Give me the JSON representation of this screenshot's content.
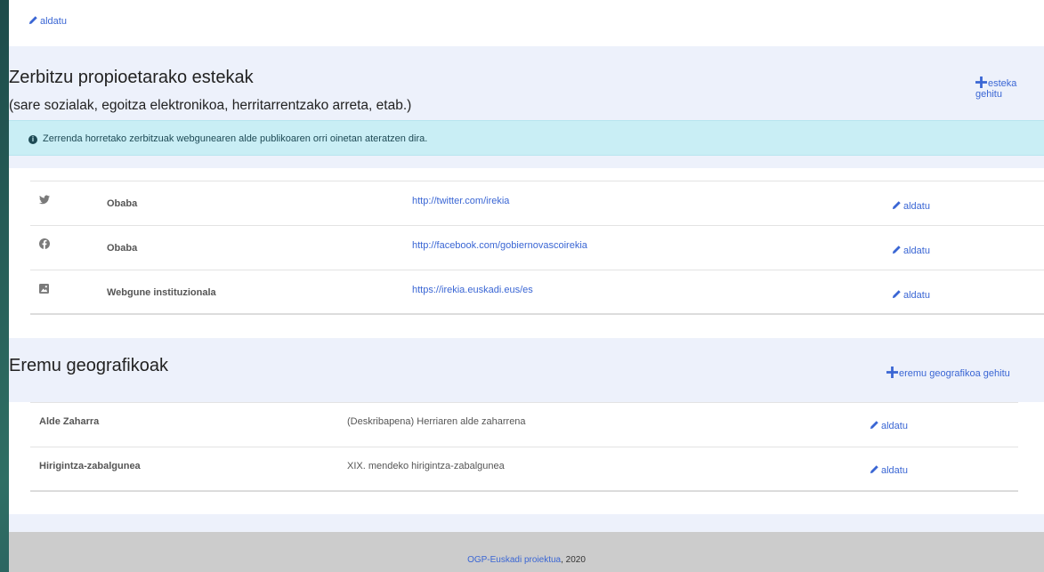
{
  "top_edit_label": "aldatu",
  "services": {
    "title": "Zerbitzu propioetarako estekak",
    "subtitle": "(sare sozialak, egoitza elektronikoa, herritarrentzako arreta, etab.)",
    "add_label": "esteka gehitu",
    "info": "Zerrenda horretako zerbitzuak webgunearen alde publikoaren orri oinetan ateratzen dira.",
    "rows": [
      {
        "icon": "twitter-icon",
        "name": "Obaba",
        "url": "http://twitter.com/irekia",
        "edit": "aldatu"
      },
      {
        "icon": "facebook-icon",
        "name": "Obaba",
        "url": "http://facebook.com/gobiernovascoirekia",
        "edit": "aldatu"
      },
      {
        "icon": "image-icon",
        "name": "Webgune instituzionala",
        "url": "https://irekia.euskadi.eus/es",
        "edit": "aldatu"
      }
    ]
  },
  "geo": {
    "title": "Eremu geografikoak",
    "add_label": "eremu geografikoa gehitu",
    "rows": [
      {
        "name": "Alde Zaharra",
        "desc": "(Deskribapena) Herriaren alde zaharrena",
        "edit": "aldatu"
      },
      {
        "name": "Hirigintza-zabalgunea",
        "desc": "XIX. mendeko hirigintza-zabalgunea",
        "edit": "aldatu"
      }
    ]
  },
  "footer": {
    "link": "OGP-Euskadi proiektua",
    "suffix": ", 2020"
  },
  "colors": {
    "link": "#3a66d4",
    "band": "#edf1fb",
    "info_bg": "#c9eef5",
    "footer_bg": "#cccccc"
  }
}
